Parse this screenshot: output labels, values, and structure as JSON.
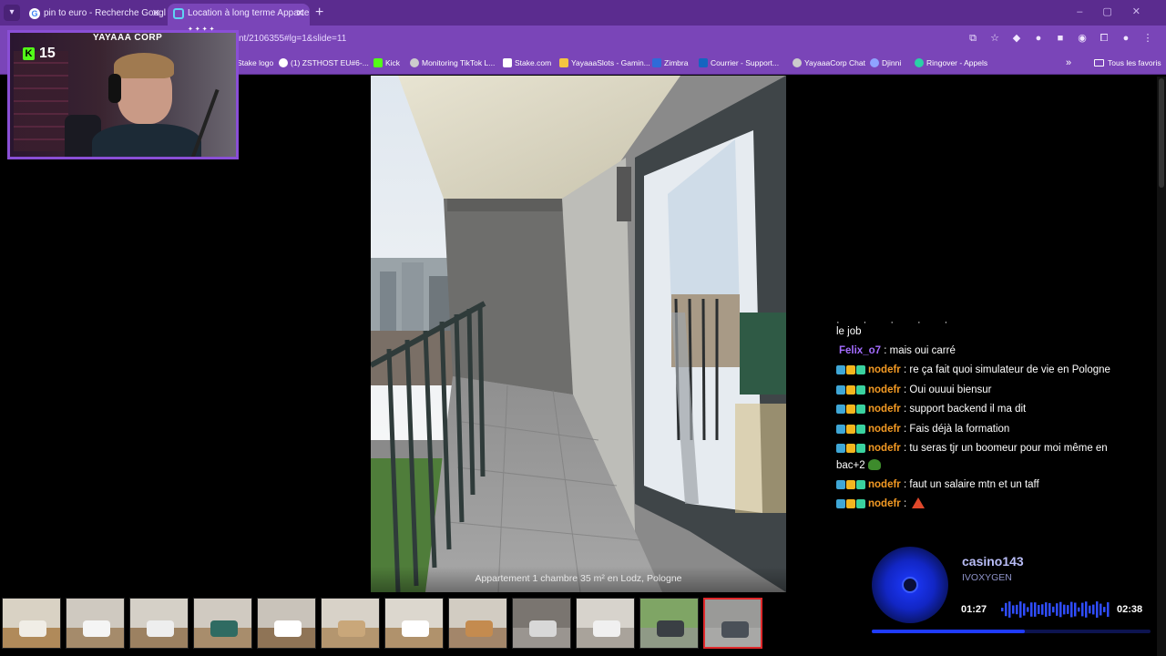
{
  "browser": {
    "tabs": [
      {
        "title": "pin to euro - Recherche Google",
        "icon": "google-icon"
      },
      {
        "title": "Location à long terme Appartem",
        "icon": "site-icon"
      }
    ],
    "url_partial": "nt/2106355#lg=1&slide=11",
    "bookmarks": [
      {
        "label": "Stake logo",
        "color": "#3aa0ff"
      },
      {
        "label": "(1) ZSTHOST EU#6-...",
        "color": "#ffffff"
      },
      {
        "label": "Kick",
        "color": "#53fc18"
      },
      {
        "label": "Monitoring TikTok L...",
        "color": "#cccccc"
      },
      {
        "label": "Stake.com",
        "color": "#ffffff"
      },
      {
        "label": "YayaaaSlots - Gamin...",
        "color": "#f5c542"
      },
      {
        "label": "Zimbra",
        "color": "#2f6bd8"
      },
      {
        "label": "Courrier - Support...",
        "color": "#1565c0"
      },
      {
        "label": "YayaaaCorp Chat",
        "color": "#cccccc"
      },
      {
        "label": "Djinni",
        "color": "#8fa3ff"
      },
      {
        "label": "Ringover - Appels",
        "color": "#2ad1a6"
      }
    ],
    "all_bookmarks_label": "Tous les favoris"
  },
  "stream": {
    "kick_viewers": "15",
    "corp_label": "YAYAAA CORP"
  },
  "photo": {
    "caption": "Appartement 1 chambre 35 m² en Lodz, Pologne"
  },
  "thumbnails": {
    "active_index": 11,
    "items": [
      {
        "wall": "#d9d2c4",
        "floor": "#b08a5a",
        "obj": "#f0ede6"
      },
      {
        "wall": "#cfc9c0",
        "floor": "#a58b6b",
        "obj": "#f5f5f5"
      },
      {
        "wall": "#d5d0c7",
        "floor": "#9c8161",
        "obj": "#eeeeee"
      },
      {
        "wall": "#d0cac1",
        "floor": "#a88d6c",
        "obj": "#2f6b62"
      },
      {
        "wall": "#c9c3ba",
        "floor": "#8f7456",
        "obj": "#ffffff"
      },
      {
        "wall": "#d8d2c8",
        "floor": "#b4966f",
        "obj": "#c9a77a"
      },
      {
        "wall": "#dcd7ce",
        "floor": "#b0926c",
        "obj": "#ffffff"
      },
      {
        "wall": "#d2ccc2",
        "floor": "#a3866a",
        "obj": "#c48b4f"
      },
      {
        "wall": "#7a7570",
        "floor": "#9a9590",
        "obj": "#d8d8d8"
      },
      {
        "wall": "#d7d3cc",
        "floor": "#a9a39b",
        "obj": "#f0f0f0"
      },
      {
        "wall": "#7fa565",
        "floor": "#8f9a86",
        "obj": "#3a3f44"
      },
      {
        "wall": "#9a9a98",
        "floor": "#a8a8a6",
        "obj": "#4a5058"
      }
    ]
  },
  "chat": {
    "lines": [
      {
        "user": "",
        "text": "le job",
        "user_color": "#ffffff",
        "badges": false
      },
      {
        "user": "Felix_o7",
        "text": "mais oui carré",
        "user_color": "#a46cff",
        "badges": false
      },
      {
        "user": "nodefr",
        "text": "re ça fait quoi simulateur de vie en Pologne",
        "user_color": "#f39a24",
        "badges": true
      },
      {
        "user": "nodefr",
        "text": "Oui ouuui biensur",
        "user_color": "#f39a24",
        "badges": true
      },
      {
        "user": "nodefr",
        "text": "support backend il ma dit",
        "user_color": "#f39a24",
        "badges": true
      },
      {
        "user": "nodefr",
        "text": "Fais déjà la formation",
        "user_color": "#f39a24",
        "badges": true
      },
      {
        "user": "nodefr",
        "text": "tu seras tjr un boomeur pour moi même en bac+2",
        "user_color": "#f39a24",
        "badges": true,
        "emote": "frog"
      },
      {
        "user": "nodefr",
        "text": "faut un salaire mtn et un taff",
        "user_color": "#f39a24",
        "badges": true
      },
      {
        "user": "nodefr",
        "text": "",
        "user_color": "#f39a24",
        "badges": true,
        "emote": "warn"
      }
    ]
  },
  "music": {
    "title": "casino143",
    "artist": "IVOXYGEN",
    "time_elapsed": "01:27",
    "time_total": "02:38",
    "progress": 0.55
  }
}
